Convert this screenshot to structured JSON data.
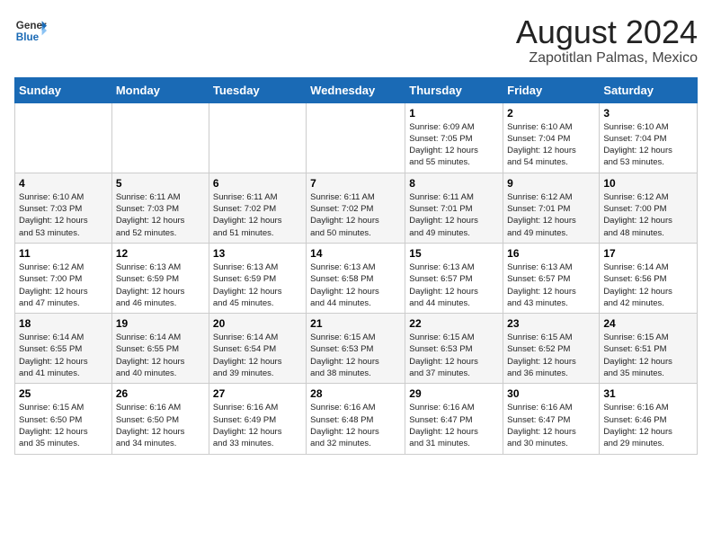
{
  "header": {
    "logo_line1": "General",
    "logo_line2": "Blue",
    "month_title": "August 2024",
    "location": "Zapotitlan Palmas, Mexico"
  },
  "days_of_week": [
    "Sunday",
    "Monday",
    "Tuesday",
    "Wednesday",
    "Thursday",
    "Friday",
    "Saturday"
  ],
  "weeks": [
    [
      {
        "day": "",
        "info": ""
      },
      {
        "day": "",
        "info": ""
      },
      {
        "day": "",
        "info": ""
      },
      {
        "day": "",
        "info": ""
      },
      {
        "day": "1",
        "info": "Sunrise: 6:09 AM\nSunset: 7:05 PM\nDaylight: 12 hours\nand 55 minutes."
      },
      {
        "day": "2",
        "info": "Sunrise: 6:10 AM\nSunset: 7:04 PM\nDaylight: 12 hours\nand 54 minutes."
      },
      {
        "day": "3",
        "info": "Sunrise: 6:10 AM\nSunset: 7:04 PM\nDaylight: 12 hours\nand 53 minutes."
      }
    ],
    [
      {
        "day": "4",
        "info": "Sunrise: 6:10 AM\nSunset: 7:03 PM\nDaylight: 12 hours\nand 53 minutes."
      },
      {
        "day": "5",
        "info": "Sunrise: 6:11 AM\nSunset: 7:03 PM\nDaylight: 12 hours\nand 52 minutes."
      },
      {
        "day": "6",
        "info": "Sunrise: 6:11 AM\nSunset: 7:02 PM\nDaylight: 12 hours\nand 51 minutes."
      },
      {
        "day": "7",
        "info": "Sunrise: 6:11 AM\nSunset: 7:02 PM\nDaylight: 12 hours\nand 50 minutes."
      },
      {
        "day": "8",
        "info": "Sunrise: 6:11 AM\nSunset: 7:01 PM\nDaylight: 12 hours\nand 49 minutes."
      },
      {
        "day": "9",
        "info": "Sunrise: 6:12 AM\nSunset: 7:01 PM\nDaylight: 12 hours\nand 49 minutes."
      },
      {
        "day": "10",
        "info": "Sunrise: 6:12 AM\nSunset: 7:00 PM\nDaylight: 12 hours\nand 48 minutes."
      }
    ],
    [
      {
        "day": "11",
        "info": "Sunrise: 6:12 AM\nSunset: 7:00 PM\nDaylight: 12 hours\nand 47 minutes."
      },
      {
        "day": "12",
        "info": "Sunrise: 6:13 AM\nSunset: 6:59 PM\nDaylight: 12 hours\nand 46 minutes."
      },
      {
        "day": "13",
        "info": "Sunrise: 6:13 AM\nSunset: 6:59 PM\nDaylight: 12 hours\nand 45 minutes."
      },
      {
        "day": "14",
        "info": "Sunrise: 6:13 AM\nSunset: 6:58 PM\nDaylight: 12 hours\nand 44 minutes."
      },
      {
        "day": "15",
        "info": "Sunrise: 6:13 AM\nSunset: 6:57 PM\nDaylight: 12 hours\nand 44 minutes."
      },
      {
        "day": "16",
        "info": "Sunrise: 6:13 AM\nSunset: 6:57 PM\nDaylight: 12 hours\nand 43 minutes."
      },
      {
        "day": "17",
        "info": "Sunrise: 6:14 AM\nSunset: 6:56 PM\nDaylight: 12 hours\nand 42 minutes."
      }
    ],
    [
      {
        "day": "18",
        "info": "Sunrise: 6:14 AM\nSunset: 6:55 PM\nDaylight: 12 hours\nand 41 minutes."
      },
      {
        "day": "19",
        "info": "Sunrise: 6:14 AM\nSunset: 6:55 PM\nDaylight: 12 hours\nand 40 minutes."
      },
      {
        "day": "20",
        "info": "Sunrise: 6:14 AM\nSunset: 6:54 PM\nDaylight: 12 hours\nand 39 minutes."
      },
      {
        "day": "21",
        "info": "Sunrise: 6:15 AM\nSunset: 6:53 PM\nDaylight: 12 hours\nand 38 minutes."
      },
      {
        "day": "22",
        "info": "Sunrise: 6:15 AM\nSunset: 6:53 PM\nDaylight: 12 hours\nand 37 minutes."
      },
      {
        "day": "23",
        "info": "Sunrise: 6:15 AM\nSunset: 6:52 PM\nDaylight: 12 hours\nand 36 minutes."
      },
      {
        "day": "24",
        "info": "Sunrise: 6:15 AM\nSunset: 6:51 PM\nDaylight: 12 hours\nand 35 minutes."
      }
    ],
    [
      {
        "day": "25",
        "info": "Sunrise: 6:15 AM\nSunset: 6:50 PM\nDaylight: 12 hours\nand 35 minutes."
      },
      {
        "day": "26",
        "info": "Sunrise: 6:16 AM\nSunset: 6:50 PM\nDaylight: 12 hours\nand 34 minutes."
      },
      {
        "day": "27",
        "info": "Sunrise: 6:16 AM\nSunset: 6:49 PM\nDaylight: 12 hours\nand 33 minutes."
      },
      {
        "day": "28",
        "info": "Sunrise: 6:16 AM\nSunset: 6:48 PM\nDaylight: 12 hours\nand 32 minutes."
      },
      {
        "day": "29",
        "info": "Sunrise: 6:16 AM\nSunset: 6:47 PM\nDaylight: 12 hours\nand 31 minutes."
      },
      {
        "day": "30",
        "info": "Sunrise: 6:16 AM\nSunset: 6:47 PM\nDaylight: 12 hours\nand 30 minutes."
      },
      {
        "day": "31",
        "info": "Sunrise: 6:16 AM\nSunset: 6:46 PM\nDaylight: 12 hours\nand 29 minutes."
      }
    ]
  ]
}
